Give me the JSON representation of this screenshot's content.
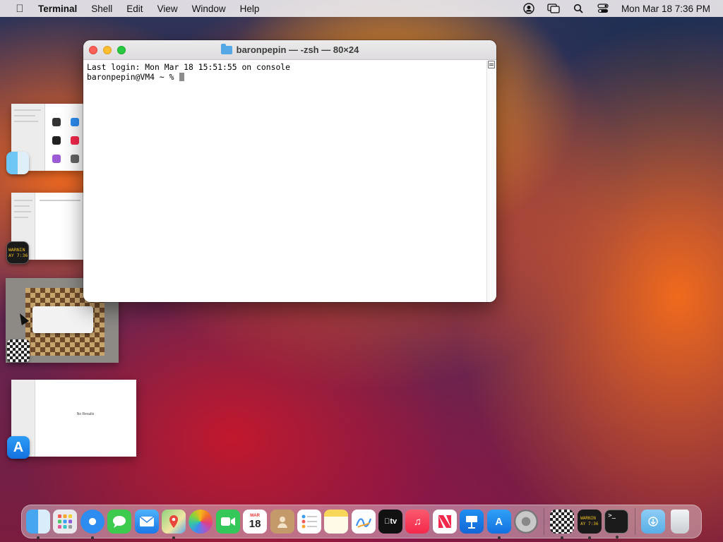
{
  "menubar": {
    "app_name": "Terminal",
    "items": [
      "Shell",
      "Edit",
      "View",
      "Window",
      "Help"
    ],
    "clock": "Mon Mar 18  7:36 PM",
    "status_icons": [
      "user-icon",
      "screen-mirror-icon",
      "search-icon",
      "control-center-icon"
    ]
  },
  "window": {
    "title": "baronpepin — -zsh — 80×24",
    "lines": [
      "Last login: Mon Mar 18 15:51:55 on console",
      "baronpepin@VM4 ~ % "
    ]
  },
  "stage": {
    "console_text": "WARNIN\nAY 7:36",
    "appstore_glyph": "A",
    "placeholder_text": "No Results"
  },
  "dock": {
    "calendar_month": "MAR",
    "calendar_day": "18",
    "tv_label": "tv",
    "console_text": "WARNIN\nAY 7:36",
    "terminal_prompt": ">_",
    "items": [
      "Finder",
      "Launchpad",
      "Safari",
      "Messages",
      "Mail",
      "Maps",
      "Photos",
      "FaceTime",
      "Calendar",
      "Contacts",
      "Reminders",
      "Notes",
      "Freeform",
      "TV",
      "Music",
      "News",
      "Keynote",
      "App Store",
      "System Settings",
      "Chess",
      "Console",
      "Terminal",
      "Downloads",
      "Trash"
    ]
  }
}
